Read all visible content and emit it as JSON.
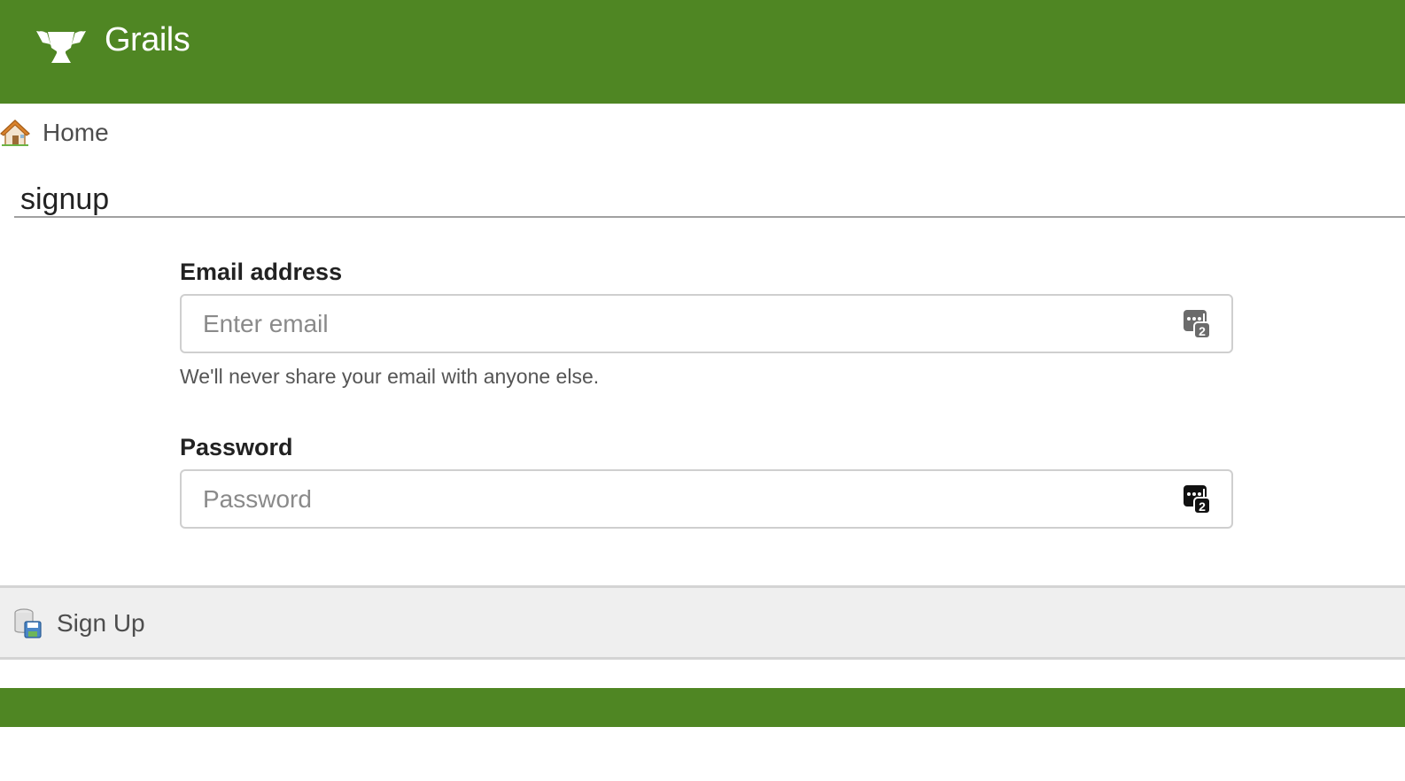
{
  "header": {
    "brand": "Grails",
    "logo_icon": "grails-cup-icon",
    "background_color": "#4f8623"
  },
  "nav": {
    "home_label": "Home",
    "home_icon": "house-icon"
  },
  "page": {
    "title": "signup"
  },
  "form": {
    "email": {
      "label": "Email address",
      "placeholder": "Enter email",
      "value": "",
      "help_text": "We'll never share your email with anyone else.",
      "autofill_icon": "password-manager-icon"
    },
    "password": {
      "label": "Password",
      "placeholder": "Password",
      "value": "",
      "autofill_icon": "password-manager-icon"
    }
  },
  "buttons": {
    "signup_label": "Sign Up",
    "signup_icon": "save-database-icon"
  },
  "footer": {
    "background_color": "#4f8623"
  }
}
